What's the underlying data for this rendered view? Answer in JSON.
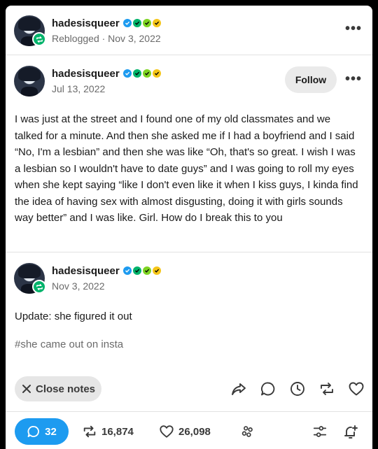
{
  "reblog_header": {
    "username": "hadesisqueer",
    "meta": "Reblogged · Nov 3, 2022",
    "more_label": "•••"
  },
  "original_post": {
    "username": "hadesisqueer",
    "date": "Jul 13, 2022",
    "follow_label": "Follow",
    "more_label": "•••",
    "body": "I was just at the street and I found one of my old classmates and we talked for a minute. And then she asked me if I had a boyfriend and I said “No, I'm a lesbian” and then she was like “Oh, that's so great. I wish I was a lesbian so I wouldn't have to date guys” and I was going to roll my eyes when she kept saying “like I don't even like it when I kiss guys, I kinda find the idea of having sex with almost disgusting, doing it with girls sounds way better” and I was like. Girl. How do I break this to you"
  },
  "reblog_post": {
    "username": "hadesisqueer",
    "date": "Nov 3, 2022",
    "body": "Update: she figured it out",
    "tag": "#she came out on insta"
  },
  "actions": {
    "close_notes_label": "Close notes"
  },
  "footer": {
    "reply_count": "32",
    "reblog_count": "16,874",
    "like_count": "26,098"
  },
  "colors": {
    "badge_blue": "#1d9bf0",
    "badge_green": "#00b36b",
    "badge_yellow": "#f5c518",
    "reply_pill": "#1d9bf0"
  }
}
